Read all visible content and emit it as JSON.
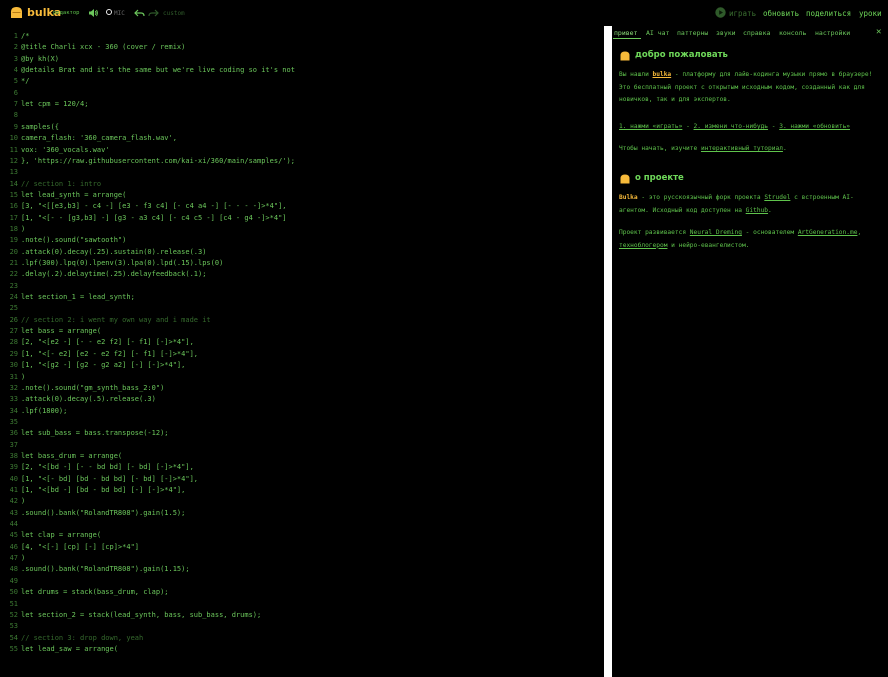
{
  "app": {
    "name": "bulka",
    "subtitle": "редактор",
    "mic_label": "MIC",
    "custom_label": "custom"
  },
  "nav": {
    "play": "играть",
    "update": "обновить",
    "share": "поделиться",
    "lessons": "уроки"
  },
  "editor": {
    "lines": [
      {
        "n": "1",
        "t": "/*"
      },
      {
        "n": "2",
        "t": "@title Charli xcx - 360 (cover / remix)"
      },
      {
        "n": "3",
        "t": "@by kh(X)"
      },
      {
        "n": "4",
        "t": "@details Brat and it's the same but we're live coding so it's not"
      },
      {
        "n": "5",
        "t": "*/"
      },
      {
        "n": "6",
        "t": ""
      },
      {
        "n": "7",
        "t": "let cpm = 120/4;"
      },
      {
        "n": "8",
        "t": ""
      },
      {
        "n": "9",
        "t": "samples({"
      },
      {
        "n": "10",
        "t": "camera_flash: '360_camera_flash.wav',"
      },
      {
        "n": "11",
        "t": "vox: '360_vocals.wav'"
      },
      {
        "n": "12",
        "t": "}, 'https://raw.githubusercontent.com/kai-xi/360/main/samples/');"
      },
      {
        "n": "13",
        "t": ""
      },
      {
        "n": "14",
        "t": "// section 1: intro"
      },
      {
        "n": "15",
        "t": "let lead_synth = arrange("
      },
      {
        "n": "16",
        "t": "[3, \"<[[e3,b3] - c4 -] [e3 - f3 c4] [- c4 a4 -] [- - - -]>*4\"],"
      },
      {
        "n": "17",
        "t": "[1, \"<[- - [g3,b3] -] [g3 - a3 c4] [- c4 c5 -] [c4 - g4 -]>*4\"]"
      },
      {
        "n": "18",
        "t": ")"
      },
      {
        "n": "19",
        "t": ".note().sound(\"sawtooth\")"
      },
      {
        "n": "20",
        "t": ".attack(0).decay(.25).sustain(0).release(.3)"
      },
      {
        "n": "21",
        "t": ".lpf(300).lpq(0).lpenv(3).lpa(0).lpd(.15).lps(0)"
      },
      {
        "n": "22",
        "t": ".delay(.2).delaytime(.25).delayfeedback(.1);"
      },
      {
        "n": "23",
        "t": ""
      },
      {
        "n": "24",
        "t": "let section_1 = lead_synth;"
      },
      {
        "n": "25",
        "t": ""
      },
      {
        "n": "26",
        "t": "// section 2: i went my own way and i made it"
      },
      {
        "n": "27",
        "t": "let bass = arrange("
      },
      {
        "n": "28",
        "t": "[2, \"<[e2 -] [- - e2 f2] [- f1] [-]>*4\"],"
      },
      {
        "n": "29",
        "t": "[1, \"<[- e2] [e2 - e2 f2] [- f1] [-]>*4\"],"
      },
      {
        "n": "30",
        "t": "[1, \"<[g2 -] [g2 - g2 a2] [-] [-]>*4\"],"
      },
      {
        "n": "31",
        "t": ")"
      },
      {
        "n": "32",
        "t": ".note().sound(\"gm_synth_bass_2:0\")"
      },
      {
        "n": "33",
        "t": ".attack(0).decay(.5).release(.3)"
      },
      {
        "n": "34",
        "t": ".lpf(1800);"
      },
      {
        "n": "35",
        "t": ""
      },
      {
        "n": "36",
        "t": "let sub_bass = bass.transpose(-12);"
      },
      {
        "n": "37",
        "t": ""
      },
      {
        "n": "38",
        "t": "let bass_drum = arrange("
      },
      {
        "n": "39",
        "t": "[2, \"<[bd -] [- - bd bd] [- bd] [-]>*4\"],"
      },
      {
        "n": "40",
        "t": "[1, \"<[- bd] [bd - bd bd] [- bd] [-]>*4\"],"
      },
      {
        "n": "41",
        "t": "[1, \"<[bd -] [bd - bd bd] [-] [-]>*4\"],"
      },
      {
        "n": "42",
        "t": ")"
      },
      {
        "n": "43",
        "t": ".sound().bank(\"RolandTR808\").gain(1.5);"
      },
      {
        "n": "44",
        "t": ""
      },
      {
        "n": "45",
        "t": "let clap = arrange("
      },
      {
        "n": "46",
        "t": "[4, \"<[-] [cp] [-] [cp]>*4\"]"
      },
      {
        "n": "47",
        "t": ")"
      },
      {
        "n": "48",
        "t": ".sound().bank(\"RolandTR808\").gain(1.15);"
      },
      {
        "n": "49",
        "t": ""
      },
      {
        "n": "50",
        "t": "let drums = stack(bass_drum, clap);"
      },
      {
        "n": "51",
        "t": ""
      },
      {
        "n": "52",
        "t": "let section_2 = stack(lead_synth, bass, sub_bass, drums);"
      },
      {
        "n": "53",
        "t": ""
      },
      {
        "n": "54",
        "t": "// section 3: drop down, yeah"
      },
      {
        "n": "55",
        "t": "let lead_saw = arrange("
      }
    ]
  },
  "panel": {
    "tabs": [
      "привет",
      "AI чат",
      "паттерны",
      "звуки",
      "справка",
      "консоль",
      "настройки"
    ],
    "close": "✕",
    "welcome": {
      "title": "добро пожаловать",
      "p1_a": "Вы нашли ",
      "p1_link": "bulka",
      "p1_b": " - платформу для лайв-кодинга музыки прямо в браузере! Это бесплатный проект с открытым исходным кодом, созданный как для новичков, так и для экспертов.",
      "step1": "1. нажми «играть»",
      "sep1": " - ",
      "step2": "2. измени что-нибудь",
      "sep2": " - ",
      "step3": "3. нажми «обновить»",
      "p3_a": "Чтобы начать, изучите ",
      "p3_link": "интерактивный туториал",
      "p3_b": "."
    },
    "about": {
      "title": "о проекте",
      "p1_name": "Bulka",
      "p1_a": " - это русскоязычный форк проекта ",
      "p1_link1": "Strudel",
      "p1_b": " с встроенным AI-агентом. Исходный код доступен на ",
      "p1_link2": "Github",
      "p1_c": ".",
      "p2_a": "Проект развивается ",
      "p2_link1": "Neural Dreming",
      "p2_b": " - основателем ",
      "p2_link2": "ArtGeneration.me",
      "p2_c": ", ",
      "p2_link3": "техноблогером",
      "p2_d": " и нейро-евангелистом."
    }
  }
}
